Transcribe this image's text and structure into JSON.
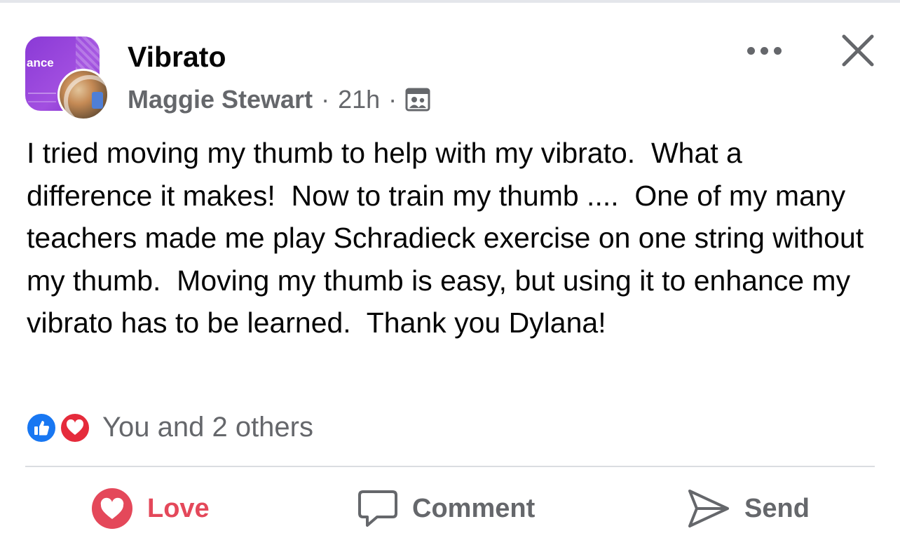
{
  "post": {
    "group_name": "Vibrato",
    "group_avatar_text": "ance",
    "author": "Maggie Stewart",
    "separator": "·",
    "time": "21h",
    "audience_icon": "group-members-icon",
    "body": "I tried moving my thumb to help with my vibrato.  What a difference it makes!  Now to train my thumb ....  One of my many teachers made me play Schradieck exercise on one string without my thumb.  Moving my thumb is easy, but using it to enhance my vibrato has to be learned.  Thank you Dylana!"
  },
  "reactions": {
    "icons": [
      "like-icon",
      "love-icon"
    ],
    "summary": "You and 2 others"
  },
  "actions": {
    "love_label": "Love",
    "comment_label": "Comment",
    "send_label": "Send"
  },
  "colors": {
    "accent_love": "#e4485a",
    "like_blue": "#1877f2",
    "secondary_text": "#65676b"
  }
}
